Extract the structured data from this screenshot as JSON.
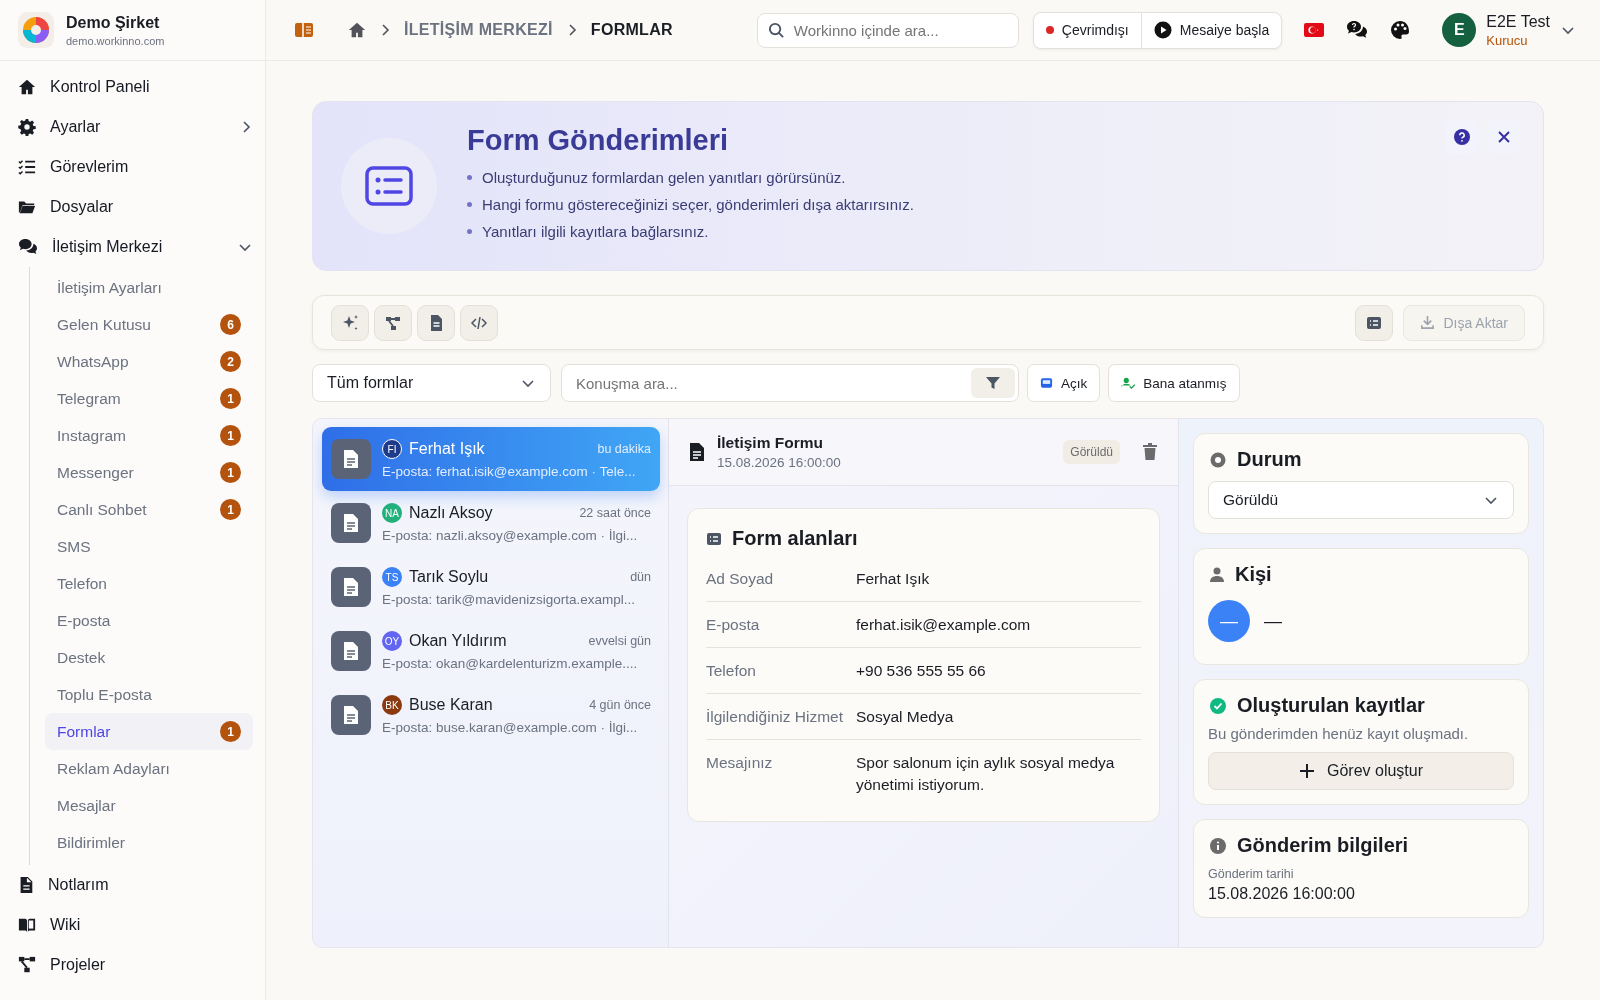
{
  "company": {
    "name": "Demo Şirket",
    "domain": "demo.workinno.com"
  },
  "breadcrumb": [
    {
      "label": "İLETİŞİM MERKEZİ",
      "current": false
    },
    {
      "label": "FORMLAR",
      "current": true
    }
  ],
  "search": {
    "placeholder": "Workinno içinde ara..."
  },
  "presence": {
    "label": "Çevrimdışı",
    "online": false
  },
  "shift_button": {
    "label": "Mesaiye başla"
  },
  "user": {
    "initial": "E",
    "name": "E2E Test",
    "role": "Kurucu"
  },
  "sidebar": {
    "items": [
      {
        "label": "Kontrol Paneli"
      },
      {
        "label": "Ayarlar",
        "expanded": false
      },
      {
        "label": "Görevlerim"
      },
      {
        "label": "Dosyalar"
      },
      {
        "label": "İletişim Merkezi",
        "expanded": true,
        "children": [
          {
            "label": "İletişim Ayarları",
            "selected": false
          },
          {
            "label": "Gelen Kutusu",
            "selected": false,
            "badge": "6"
          },
          {
            "label": "WhatsApp",
            "selected": false,
            "badge": "2"
          },
          {
            "label": "Telegram",
            "selected": false,
            "badge": "1"
          },
          {
            "label": "Instagram",
            "selected": false,
            "badge": "1"
          },
          {
            "label": "Messenger",
            "selected": false,
            "badge": "1"
          },
          {
            "label": "Canlı Sohbet",
            "selected": false,
            "badge": "1"
          },
          {
            "label": "SMS",
            "selected": false
          },
          {
            "label": "Telefon",
            "selected": false
          },
          {
            "label": "E-posta",
            "selected": false
          },
          {
            "label": "Destek",
            "selected": false
          },
          {
            "label": "Toplu E-posta",
            "selected": false
          },
          {
            "label": "Formlar",
            "selected": true,
            "badge": "1"
          },
          {
            "label": "Reklam Adayları",
            "selected": false
          },
          {
            "label": "Mesajlar",
            "selected": false
          },
          {
            "label": "Bildirimler",
            "selected": false
          }
        ]
      },
      {
        "label": "Notlarım"
      },
      {
        "label": "Wiki"
      },
      {
        "label": "Projeler"
      }
    ]
  },
  "hero": {
    "title": "Form Gönderimleri",
    "bullets": [
      "Oluşturduğunuz formlardan gelen yanıtları görürsünüz.",
      "Hangi formu göstereceğinizi seçer, gönderimleri dışa aktarırsınız.",
      "Yanıtları ilgili kayıtlara bağlarsınız."
    ]
  },
  "toolbar": {
    "export_label": "Dışa Aktar"
  },
  "filters": {
    "form_select": "Tüm formlar",
    "search_placeholder": "Konuşma ara...",
    "chips": [
      {
        "label": "Açık"
      },
      {
        "label": "Bana atanmış"
      }
    ]
  },
  "submissions": [
    {
      "initials": "FI",
      "name": "Ferhat Işık",
      "time": "bu dakika",
      "preview": "E-posta: ferhat.isik@example.com · Tele...",
      "color": "#1e3a8a",
      "selected": true
    },
    {
      "initials": "NA",
      "name": "Nazlı Aksoy",
      "time": "22 saat önce",
      "preview": "E-posta: nazli.aksoy@example.com · İlgi...",
      "color": "#22b07d",
      "selected": false
    },
    {
      "initials": "TS",
      "name": "Tarık Soylu",
      "time": "dün",
      "preview": "E-posta: tarik@mavidenizsigorta.exampl...",
      "color": "#3b82f6",
      "selected": false
    },
    {
      "initials": "OY",
      "name": "Okan Yıldırım",
      "time": "evvelsi gün",
      "preview": "E-posta: okan@kardelenturizm.example....",
      "color": "#6366f1",
      "selected": false
    },
    {
      "initials": "BK",
      "name": "Buse Karan",
      "time": "4 gün önce",
      "preview": "E-posta: buse.karan@example.com · İlgi...",
      "color": "#8b3a0f",
      "selected": false
    }
  ],
  "detail": {
    "form_name": "İletişim Formu",
    "date": "15.08.2026 16:00:00",
    "status_badge": "Görüldü",
    "fields_title": "Form alanları",
    "fields": [
      {
        "label": "Ad Soyad",
        "value": "Ferhat Işık"
      },
      {
        "label": "E-posta",
        "value": "ferhat.isik@example.com"
      },
      {
        "label": "Telefon",
        "value": "+90 536 555 55 66"
      },
      {
        "label": "İlgilendiğiniz Hizmet",
        "value": "Sosyal Medya"
      },
      {
        "label": "Mesajınız",
        "value": "Spor salonum için aylık sosyal medya yönetimi istiyorum."
      }
    ]
  },
  "status_card": {
    "title": "Durum",
    "value": "Görüldü"
  },
  "person_card": {
    "title": "Kişi",
    "avatar": "—",
    "value": "—"
  },
  "records_card": {
    "title": "Oluşturulan kayıtlar",
    "empty_text": "Bu gönderimden henüz kayıt oluşmadı.",
    "button": "Görev oluştur"
  },
  "info_card": {
    "title": "Gönderim bilgileri",
    "label": "Gönderim tarihi",
    "value": "15.08.2026 16:00:00"
  }
}
